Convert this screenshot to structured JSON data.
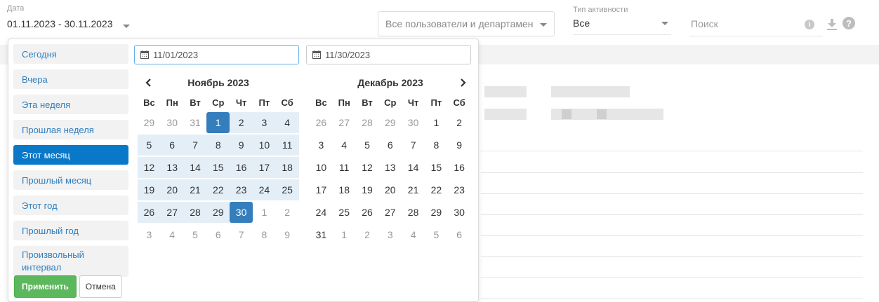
{
  "filters": {
    "date_label": "Дата",
    "date_value": "01.11.2023 - 30.11.2023",
    "users_value": "Все пользователи и департамен",
    "activity_label": "Тип активности",
    "activity_value": "Все",
    "search_placeholder": "Поиск"
  },
  "icons": {
    "info": "info-icon",
    "download": "download-icon",
    "help": "help-icon",
    "calendar": "calendar-icon"
  },
  "picker": {
    "ranges": [
      {
        "label": "Сегодня"
      },
      {
        "label": "Вчера"
      },
      {
        "label": "Эта неделя"
      },
      {
        "label": "Прошлая неделя"
      },
      {
        "label": "Этот месяц",
        "active": true
      },
      {
        "label": "Прошлый месяц"
      },
      {
        "label": "Этот год"
      },
      {
        "label": "Прошлый год"
      },
      {
        "label": "Произвольный интервал"
      }
    ],
    "start_input": "11/01/2023",
    "end_input": "11/30/2023",
    "apply_label": "Применить",
    "cancel_label": "Отмена",
    "weekdays": [
      "Вс",
      "Пн",
      "Вт",
      "Ср",
      "Чт",
      "Пт",
      "Сб"
    ],
    "left_month": {
      "title": "Ноябрь 2023",
      "weeks": [
        [
          [
            "29",
            "off"
          ],
          [
            "30",
            "off"
          ],
          [
            "31",
            "off"
          ],
          [
            "1",
            "sel"
          ],
          [
            "2",
            "in"
          ],
          [
            "3",
            "in"
          ],
          [
            "4",
            "in"
          ]
        ],
        [
          [
            "5",
            "in"
          ],
          [
            "6",
            "in"
          ],
          [
            "7",
            "in"
          ],
          [
            "8",
            "in"
          ],
          [
            "9",
            "in"
          ],
          [
            "10",
            "in"
          ],
          [
            "11",
            "in"
          ]
        ],
        [
          [
            "12",
            "in"
          ],
          [
            "13",
            "in"
          ],
          [
            "14",
            "in"
          ],
          [
            "15",
            "in"
          ],
          [
            "16",
            "in"
          ],
          [
            "17",
            "in"
          ],
          [
            "18",
            "in"
          ]
        ],
        [
          [
            "19",
            "in"
          ],
          [
            "20",
            "in"
          ],
          [
            "21",
            "in"
          ],
          [
            "22",
            "in"
          ],
          [
            "23",
            "in"
          ],
          [
            "24",
            "in"
          ],
          [
            "25",
            "in"
          ]
        ],
        [
          [
            "26",
            "in"
          ],
          [
            "27",
            "in"
          ],
          [
            "28",
            "in"
          ],
          [
            "29",
            "in"
          ],
          [
            "30",
            "sel"
          ],
          [
            "1",
            "off"
          ],
          [
            "2",
            "off"
          ]
        ],
        [
          [
            "3",
            "off"
          ],
          [
            "4",
            "off"
          ],
          [
            "5",
            "off"
          ],
          [
            "6",
            "off"
          ],
          [
            "7",
            "off"
          ],
          [
            "8",
            "off"
          ],
          [
            "9",
            "off"
          ]
        ]
      ]
    },
    "right_month": {
      "title": "Декабрь 2023",
      "weeks": [
        [
          [
            "26",
            "off"
          ],
          [
            "27",
            "off"
          ],
          [
            "28",
            "off"
          ],
          [
            "29",
            "off"
          ],
          [
            "30",
            "off"
          ],
          [
            "1",
            ""
          ],
          [
            "2",
            ""
          ]
        ],
        [
          [
            "3",
            ""
          ],
          [
            "4",
            ""
          ],
          [
            "5",
            ""
          ],
          [
            "6",
            ""
          ],
          [
            "7",
            ""
          ],
          [
            "8",
            ""
          ],
          [
            "9",
            ""
          ]
        ],
        [
          [
            "10",
            ""
          ],
          [
            "11",
            ""
          ],
          [
            "12",
            ""
          ],
          [
            "13",
            ""
          ],
          [
            "14",
            ""
          ],
          [
            "15",
            ""
          ],
          [
            "16",
            ""
          ]
        ],
        [
          [
            "17",
            ""
          ],
          [
            "18",
            ""
          ],
          [
            "19",
            ""
          ],
          [
            "20",
            ""
          ],
          [
            "21",
            ""
          ],
          [
            "22",
            ""
          ],
          [
            "23",
            ""
          ]
        ],
        [
          [
            "24",
            ""
          ],
          [
            "25",
            ""
          ],
          [
            "26",
            ""
          ],
          [
            "27",
            ""
          ],
          [
            "28",
            ""
          ],
          [
            "29",
            ""
          ],
          [
            "30",
            ""
          ]
        ],
        [
          [
            "31",
            ""
          ],
          [
            "1",
            "off"
          ],
          [
            "2",
            "off"
          ],
          [
            "3",
            "off"
          ],
          [
            "4",
            "off"
          ],
          [
            "5",
            "off"
          ],
          [
            "6",
            "off"
          ]
        ]
      ]
    }
  },
  "colors": {
    "accent": "#0a78c8",
    "selected_day": "#357ebd",
    "range_fill": "#e4eef7",
    "apply_green": "#5cb85c",
    "link_blue": "#2f7fc1"
  }
}
